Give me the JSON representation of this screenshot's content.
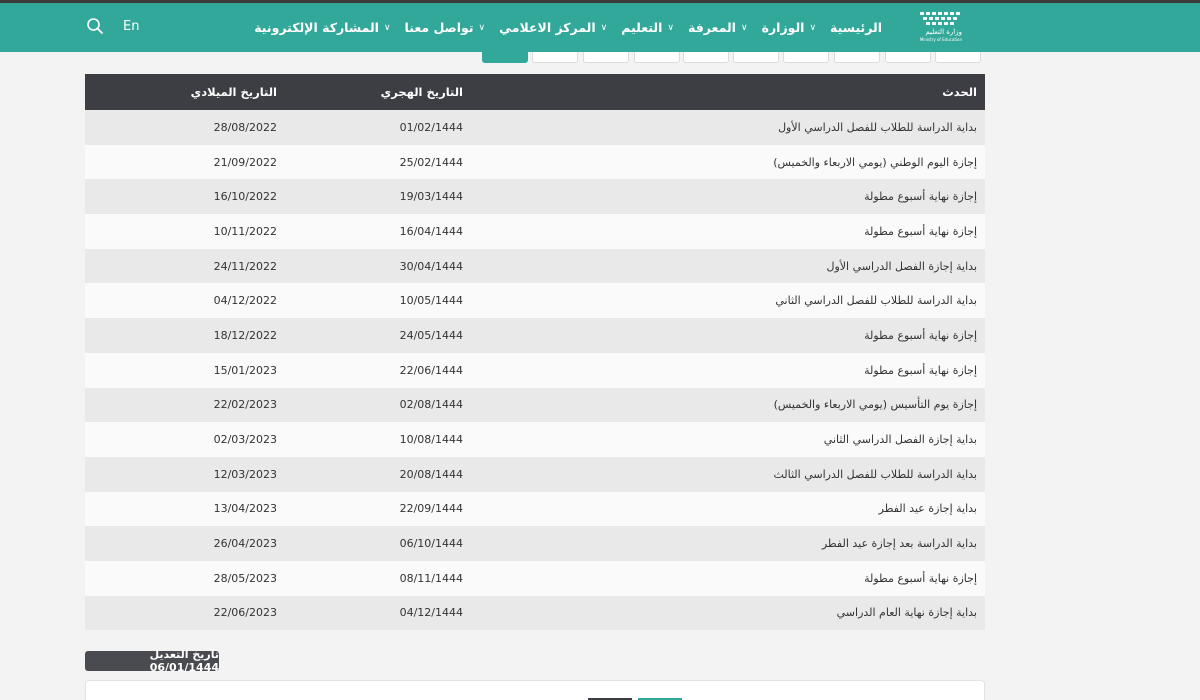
{
  "nav": {
    "logo_text": "وزارة التعليم",
    "logo_subtext": "Ministry of Education",
    "items": [
      {
        "label": "الرئيسية",
        "has_dropdown": false
      },
      {
        "label": "الوزارة",
        "has_dropdown": true
      },
      {
        "label": "المعرفة",
        "has_dropdown": true
      },
      {
        "label": "التعليم",
        "has_dropdown": true
      },
      {
        "label": "المركز الاعلامي",
        "has_dropdown": true
      },
      {
        "label": "تواصل معنا",
        "has_dropdown": true
      },
      {
        "label": "المشاركة الإلكترونية",
        "has_dropdown": true
      }
    ],
    "lang_label": "En",
    "search_icon": "search-icon"
  },
  "table": {
    "headers": {
      "event": "الحدث",
      "hijri": "التاريخ الهجري",
      "gregorian": "التاريخ الميلادي"
    },
    "rows": [
      {
        "event": "بداية الدراسة للطلاب للفصل الدراسي الأول",
        "hijri": "01/02/1444",
        "gregorian": "28/08/2022"
      },
      {
        "event": "إجازة اليوم الوطني (يومي الاربعاء والخميس)",
        "hijri": "25/02/1444",
        "gregorian": "21/09/2022"
      },
      {
        "event": "إجازة نهاية أسبوع مطولة",
        "hijri": "19/03/1444",
        "gregorian": "16/10/2022"
      },
      {
        "event": "إجازة نهاية أسبوع مطولة",
        "hijri": "16/04/1444",
        "gregorian": "10/11/2022"
      },
      {
        "event": "بداية إجازة الفصل الدراسي الأول",
        "hijri": "30/04/1444",
        "gregorian": "24/11/2022"
      },
      {
        "event": "بداية الدراسة للطلاب للفصل الدراسي الثاني",
        "hijri": "10/05/1444",
        "gregorian": "04/12/2022"
      },
      {
        "event": "إجازة نهاية أسبوع مطولة",
        "hijri": "24/05/1444",
        "gregorian": "18/12/2022"
      },
      {
        "event": "إجازة نهاية أسبوع مطولة",
        "hijri": "22/06/1444",
        "gregorian": "15/01/2023"
      },
      {
        "event": "إجازة يوم التأسيس (يومي الاربعاء والخميس)",
        "hijri": "02/08/1444",
        "gregorian": "22/02/2023"
      },
      {
        "event": "بداية إجازة الفصل الدراسي الثاني",
        "hijri": "10/08/1444",
        "gregorian": "02/03/2023"
      },
      {
        "event": "بداية الدراسة للطلاب للفصل الدراسي الثالث",
        "hijri": "20/08/1444",
        "gregorian": "12/03/2023"
      },
      {
        "event": "بداية إجازة عيد الفطر",
        "hijri": "22/09/1444",
        "gregorian": "13/04/2023"
      },
      {
        "event": "بداية الدراسة بعد إجازة عيد الفطر",
        "hijri": "06/10/1444",
        "gregorian": "26/04/2023"
      },
      {
        "event": "إجازة نهاية أسبوع مطولة",
        "hijri": "08/11/1444",
        "gregorian": "28/05/2023"
      },
      {
        "event": "بداية إجازة نهاية العام الدراسي",
        "hijri": "04/12/1444",
        "gregorian": "22/06/2023"
      }
    ]
  },
  "modified_label": "تاريخ التعديل 06/01/1444",
  "colors": {
    "accent": "#32a89a",
    "header_dark": "#3d3e44"
  }
}
